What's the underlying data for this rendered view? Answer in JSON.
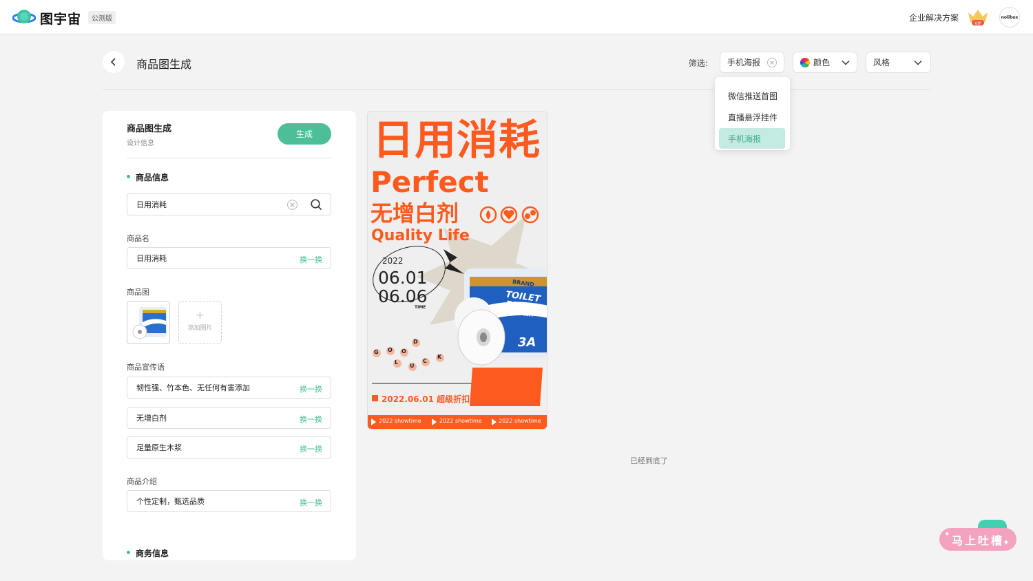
{
  "header": {
    "brand": "图宇宙",
    "badge": "公测版",
    "enterprise": "企业解决方案",
    "vip_badge": "VIP",
    "avatar_text": "nolibox"
  },
  "page": {
    "title": "商品图生成"
  },
  "filter": {
    "label": "筛选:",
    "type_value": "手机海报",
    "color_label": "颜色",
    "style_label": "风格",
    "options": [
      {
        "label": "微信推送首图"
      },
      {
        "label": "直播悬浮挂件"
      },
      {
        "label": "手机海报"
      }
    ]
  },
  "panel": {
    "title": "商品图生成",
    "subtitle": "设计信息",
    "generate": "生成",
    "section_product": "商品信息",
    "search_value": "日用消耗",
    "name_label": "商品名",
    "name_value": "日用消耗",
    "swap": "换一换",
    "image_label": "商品图",
    "add_image": "添加图片",
    "slogan_label": "商品宣传语",
    "slogans": [
      "韧性强、竹本色、无任何有害添加",
      "无增白剂",
      "足量原生木浆"
    ],
    "intro_label": "商品介绍",
    "intro_value": "个性定制，甄选品质",
    "section_business": "商务信息"
  },
  "poster": {
    "headline": "日用消耗",
    "perfect": "Perfect",
    "sub": "无增白剂",
    "quality": "Quality Life",
    "year": "2022",
    "date1": "06.01",
    "date2": "06.06",
    "time": "TIME",
    "brand": "BRAND",
    "toilet": "TOILET",
    "paper": "PAPER",
    "extra": "EXTRA SOFT",
    "pack": "3A",
    "luck_letters": [
      "G",
      "O",
      "O",
      "D",
      "L",
      "U",
      "C",
      "K"
    ],
    "promo": "2022.06.01 超级折扣",
    "ticker": [
      "2022 showtime",
      "2022 showtime",
      "2022 showtime"
    ],
    "colors": {
      "accent": "#fc5a1f",
      "bg": "#efefef"
    }
  },
  "footer_tip": "已经到底了",
  "feedback": "马上吐槽"
}
